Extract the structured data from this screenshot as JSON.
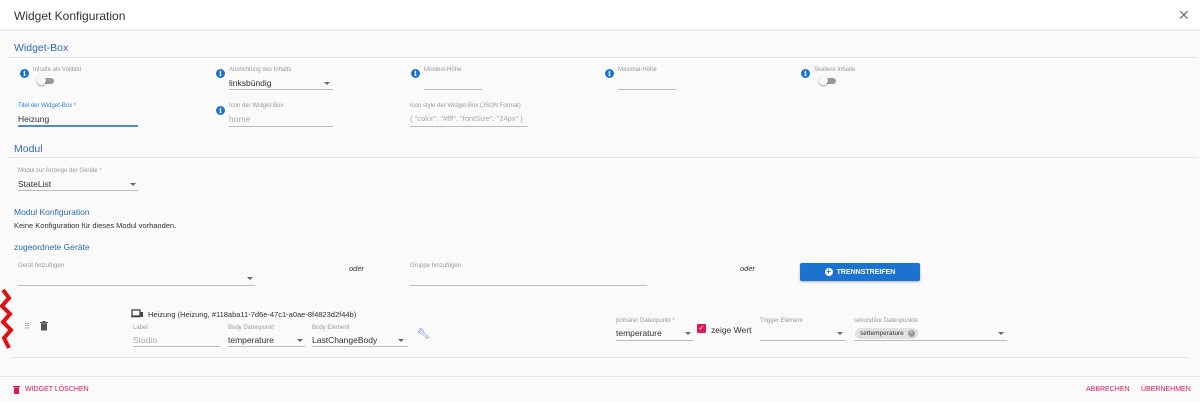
{
  "dialog": {
    "title": "Widget Konfiguration",
    "close_icon": "close-icon"
  },
  "widget_box": {
    "heading": "Widget-Box",
    "fullscreen_label": "Inhalte als Vollbild",
    "fullscreen_on": false,
    "alignment_label": "Ausrichtung des Inhalts",
    "alignment_value": "linksbündig",
    "min_height_label": "Mindest-Höhe",
    "min_height_value": "",
    "max_height_label": "Maximal-Höhe",
    "max_height_value": "",
    "scale_label": "Skaliere Inhalte",
    "scale_on": false,
    "title_label": "Titel der Widget-Box *",
    "title_value": "Heizung",
    "icon_label": "Icon der Widget-Box",
    "icon_placeholder": "home",
    "icon_style_label": "Icon style der Widget-Box (JSON Format)",
    "icon_style_placeholder": "{ \"color\": \"#fff\", \"fontSize\": \"24px\" }"
  },
  "modul": {
    "heading": "Modul",
    "module_label": "Modul zur Anzeige der Geräte *",
    "module_value": "StateList",
    "config_heading": "Modul Konfiguration",
    "config_text": "Keine Konfiguration für dieses Modul vorhanden.",
    "devices_heading": "zugeordnete Geräte",
    "add_device_label": "Gerät hinzufügen",
    "or1": "oder",
    "add_group_label": "Gruppe hinzufügen",
    "or2": "oder",
    "separator_button": "TRENNSTREIFEN"
  },
  "device": {
    "name": "Heizung (Heizung, #118aba11-7d6e-47c1-a0ae-8f4823d2f44b)",
    "label_label": "Label",
    "label_placeholder": "Studio",
    "body_dp_label": "Body Datenpunkt",
    "body_dp_value": "temperature",
    "body_el_label": "Body Element",
    "body_el_value": "LastChangeBody",
    "primary_label": "primärer Datenpunkt *",
    "primary_value": "temperature",
    "show_value_label": "zeige Wert",
    "show_value_checked": true,
    "trigger_label": "Trigger Element",
    "trigger_value": "",
    "secondary_label": "sekundäre Datenpunkte",
    "secondary_chips": [
      "settemperature"
    ]
  },
  "footer": {
    "delete": "WIDGET LÖSCHEN",
    "cancel": "ABBRECHEN",
    "apply": "ÜBERNEHMEN"
  },
  "colors": {
    "accent": "#1a73d1",
    "danger": "#e0185a",
    "heading": "#2a6bb8"
  }
}
